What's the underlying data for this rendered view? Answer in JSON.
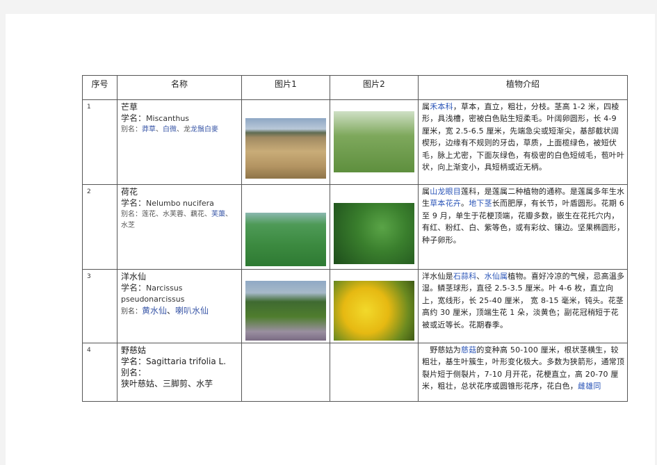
{
  "headers": [
    "序号",
    "名称",
    "图片1",
    "图片2",
    "植物介绍"
  ],
  "rows": [
    {
      "index": "1",
      "cn_name": "芒草",
      "sci_label": "学名：",
      "sci_name": "Miscanthus",
      "alias_label": "别名：",
      "alias_items": [
        "莽草",
        "白微",
        "龙鬚白麥"
      ],
      "desc_parts": [
        {
          "text": "属",
          "link": false
        },
        {
          "text": "禾本科",
          "link": true
        },
        {
          "text": "，草本，直立，粗壮，分枝。茎高 1-2 米，四棱形，具浅槽，密被白色贴生短柔毛。叶阔卵圆形，长 4-9 厘米，宽 2.5-6.5 厘米，先端急尖或短渐尖，基部截状阔楔形，边缘有不规则的牙齿，草质，上面榄绿色，被短伏毛，脉上尤密，下面灰绿色，有极密的白色短绒毛，苞叶叶状，向上渐变小，具短柄或近无柄。",
          "link": false
        }
      ]
    },
    {
      "index": "2",
      "cn_name": "荷花",
      "sci_label": "学名：",
      "sci_name": "Nelumbo nucifera",
      "alias_label": "别名：",
      "alias_items": [
        "莲花",
        "水芙蓉",
        "藕花",
        "芙蕖",
        "水芝"
      ],
      "desc_parts": [
        {
          "text": "属",
          "link": false
        },
        {
          "text": "山龙眼目",
          "link": true
        },
        {
          "text": "莲科，是莲属二种植物的通称。是莲属多年生水生",
          "link": false
        },
        {
          "text": "草本花卉",
          "link": true
        },
        {
          "text": "。",
          "link": false
        },
        {
          "text": "地下茎",
          "link": true
        },
        {
          "text": "长而肥厚，有长节，叶盾圆形。花期 6 至 9 月，单生于花梗顶端，花瓣多数，嵌生在花托穴内，有红、粉红、白、紫等色，或有彩纹、镶边。坚果椭圆形，种子卵形。",
          "link": false
        }
      ]
    },
    {
      "index": "3",
      "cn_name": "洋水仙",
      "sci_label": "学名：",
      "sci_name": "Narcissus pseudonarcissus",
      "alias_label": "别名：",
      "alias_items": [
        "黄水仙",
        "喇叭水仙"
      ],
      "desc_parts": [
        {
          "text": "洋水仙是",
          "link": false
        },
        {
          "text": "石蒜科",
          "link": true
        },
        {
          "text": "、",
          "link": false
        },
        {
          "text": "水仙属",
          "link": true
        },
        {
          "text": "植物。喜好冷凉的气候，忌高温多湿。鳞茎球形，直径 2.5-3.5 厘米。叶 4-6 枚，直立向上，宽线形，长 25-40 厘米， 宽 8-15 毫米，钝头。花茎高约 30 厘米，顶端生花 1 朵，淡黄色；副花冠稍短于花被或近等长。花期春季。",
          "link": false
        }
      ]
    },
    {
      "index": "4",
      "cn_name": "野慈姑",
      "sci_label": "学名：",
      "sci_name": "Sagittaria trifolia L.",
      "alias_label": "别名：",
      "alias_items": [
        "狭叶慈姑",
        "三脚剪",
        "水芋"
      ],
      "desc_parts": [
        {
          "text": "　野慈姑为",
          "link": false
        },
        {
          "text": "慈菇",
          "link": true
        },
        {
          "text": "的变种高 50-100 厘米，根状茎横生，较粗壮，基生叶簇生，叶形变化极大。多数为狭箭形，通常顶裂片短于侧裂片，7-10 月开花，花梗直立，高 20-70 厘米，粗壮，总状花序或圆锥形花序，花白色，",
          "link": false
        },
        {
          "text": "雌雄同",
          "link": true
        }
      ]
    }
  ]
}
